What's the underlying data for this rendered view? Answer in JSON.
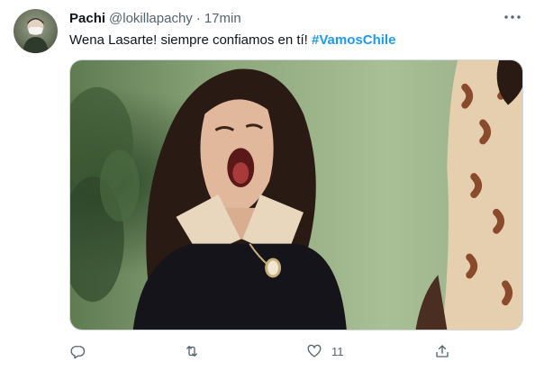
{
  "tweet": {
    "display_name": "Pachi",
    "handle": "@lokillapachy",
    "separator": "·",
    "time": "17min",
    "text_plain": "Wena Lasarte! siempre confiamos en tí! ",
    "hashtag": "#VamosChile",
    "media_icon": "meme-photo",
    "actions": {
      "reply": {
        "icon": "reply-icon",
        "count": ""
      },
      "retweet": {
        "icon": "retweet-icon",
        "count": ""
      },
      "like": {
        "icon": "heart-icon",
        "count": "11"
      },
      "share": {
        "icon": "share-icon",
        "count": ""
      }
    }
  },
  "colors": {
    "text": "#0f1419",
    "secondary": "#536471",
    "hashtag": "#1d9bf0",
    "border": "#cfd9de"
  }
}
